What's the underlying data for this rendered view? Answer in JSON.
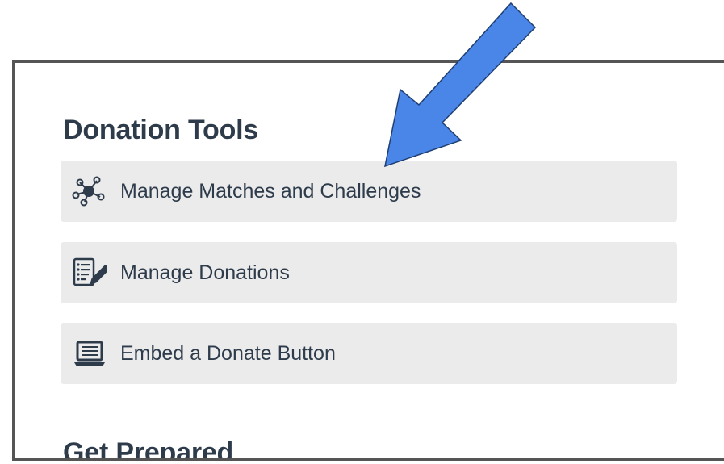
{
  "donation_tools": {
    "title": "Donation Tools",
    "items": [
      {
        "label": "Manage Matches and Challenges",
        "icon": "network-nodes-icon"
      },
      {
        "label": "Manage Donations",
        "icon": "edit-list-icon"
      },
      {
        "label": "Embed a Donate Button",
        "icon": "laptop-icon"
      }
    ]
  },
  "get_prepared": {
    "title": "Get Prepared"
  },
  "annotation": {
    "arrow_color": "#4a86e8",
    "arrow_icon": "pointer-arrow-icon"
  }
}
